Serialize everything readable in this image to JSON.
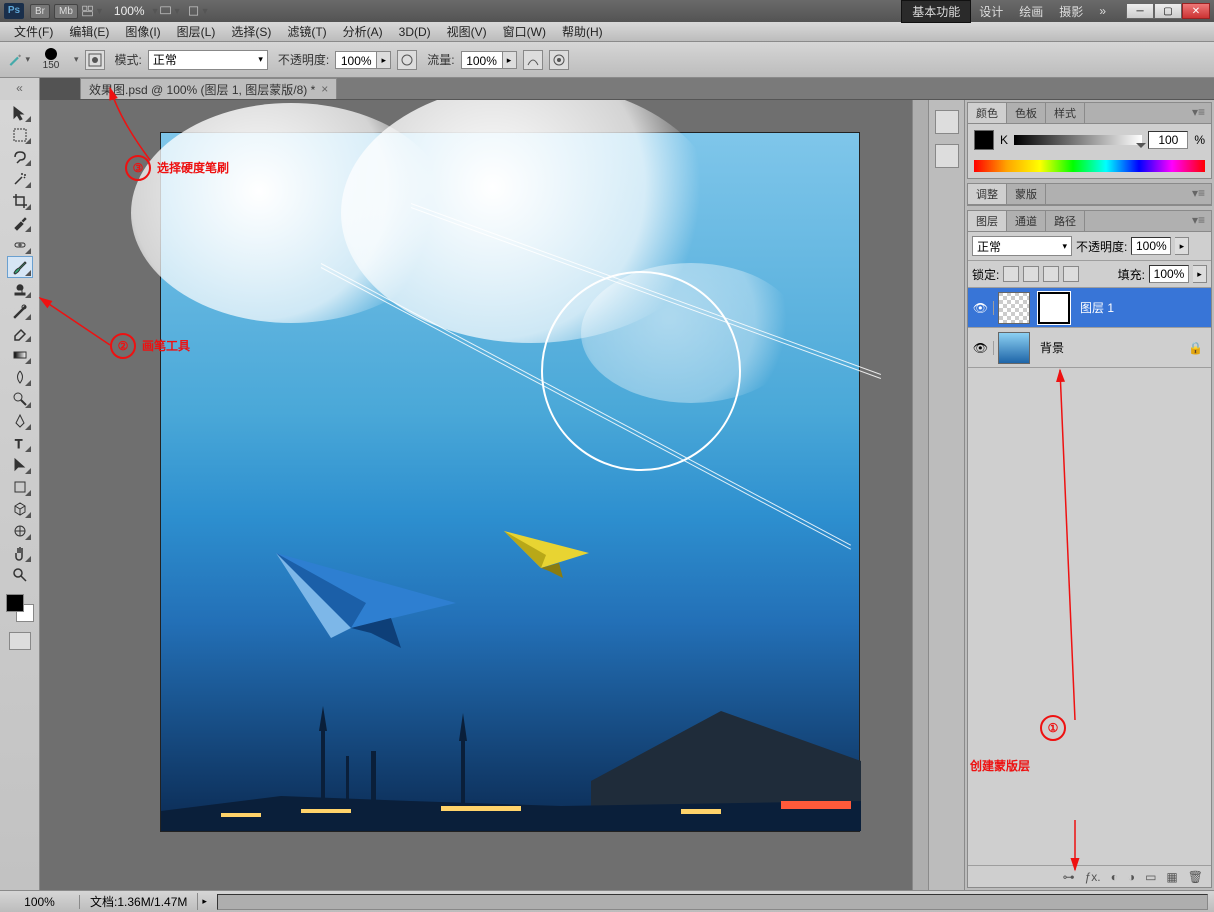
{
  "titlebar": {
    "br": "Br",
    "mb": "Mb",
    "zoom": "100%"
  },
  "workspace": {
    "basic": "基本功能",
    "design": "设计",
    "paint": "绘画",
    "photo": "摄影"
  },
  "menu": {
    "file": "文件(F)",
    "edit": "编辑(E)",
    "image": "图像(I)",
    "layer": "图层(L)",
    "select": "选择(S)",
    "filter": "滤镜(T)",
    "analysis": "分析(A)",
    "threeD": "3D(D)",
    "view": "视图(V)",
    "window": "窗口(W)",
    "help": "帮助(H)"
  },
  "options": {
    "brush_size": "150",
    "mode_label": "模式:",
    "mode_value": "正常",
    "opacity_label": "不透明度:",
    "opacity_value": "100%",
    "flow_label": "流量:",
    "flow_value": "100%"
  },
  "doc": {
    "tab": "效果图.psd @ 100% (图层 1, 图层蒙版/8) *"
  },
  "panels": {
    "color": {
      "tab_color": "颜色",
      "tab_swatch": "色板",
      "tab_style": "样式",
      "k": "K",
      "k_val": "100",
      "pct": "%"
    },
    "adjust": {
      "tab_adjust": "调整",
      "tab_mask": "蒙版"
    },
    "layers": {
      "tab_layers": "图层",
      "tab_channels": "通道",
      "tab_paths": "路径",
      "blend": "正常",
      "opacity_label": "不透明度:",
      "opacity": "100%",
      "lock_label": "锁定:",
      "fill_label": "填充:",
      "fill": "100%",
      "layer1": "图层 1",
      "bg": "背景"
    }
  },
  "status": {
    "zoom": "100%",
    "docinfo": "文档:1.36M/1.47M"
  },
  "annot": {
    "n1": "①",
    "t1": "创建蒙版层",
    "n2": "②",
    "t2": "画笔工具",
    "n3": "③",
    "t3": "选择硬度笔刷"
  }
}
